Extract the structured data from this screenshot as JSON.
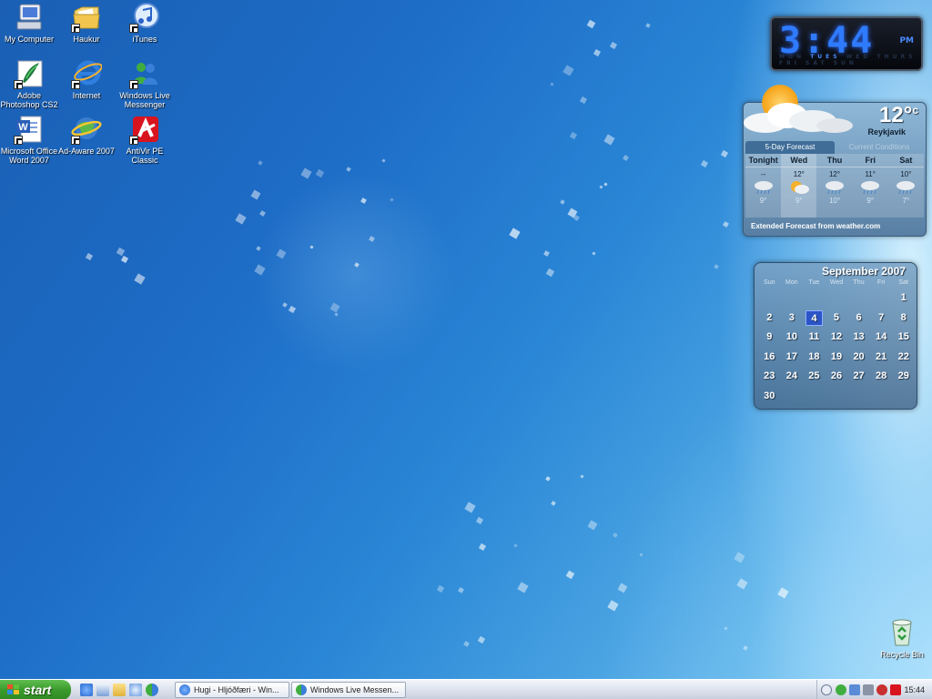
{
  "desktop_icons": [
    {
      "label": "My Computer",
      "icon": "computer-icon"
    },
    {
      "label": "Haukur",
      "icon": "folder-icon"
    },
    {
      "label": "iTunes",
      "icon": "itunes-icon"
    },
    {
      "label": "Adobe Photoshop CS2",
      "icon": "photoshop-icon"
    },
    {
      "label": "Internet",
      "icon": "internet-explorer-icon"
    },
    {
      "label": "Windows Live Messenger",
      "icon": "messenger-icon"
    },
    {
      "label": "Microsoft Office Word 2007",
      "icon": "word-icon"
    },
    {
      "label": "Ad-Aware 2007",
      "icon": "adaware-icon"
    },
    {
      "label": "AntiVir PE Classic",
      "icon": "antivir-icon"
    },
    {
      "label": "Recycle Bin",
      "icon": "recycle-bin-icon"
    }
  ],
  "clock": {
    "time": "3:44",
    "ampm": "PM",
    "days": [
      "MON",
      "TUES",
      "WED",
      "THURS",
      "FRI",
      "SAT",
      "SUN"
    ],
    "active_day": "TUES"
  },
  "weather": {
    "temp": "12°",
    "unit": "c",
    "city": "Reykjavik",
    "tabs": [
      "5-Day Forecast",
      "Current Conditions"
    ],
    "active_tab": "5-Day Forecast",
    "forecast": [
      {
        "day": "Tonight",
        "high": "--",
        "low": "9°",
        "icon": "rain-icon"
      },
      {
        "day": "Wed",
        "high": "12°",
        "low": "9°",
        "icon": "sun-cloud-icon"
      },
      {
        "day": "Thu",
        "high": "12°",
        "low": "10°",
        "icon": "rain-icon"
      },
      {
        "day": "Fri",
        "high": "11°",
        "low": "9°",
        "icon": "rain-icon"
      },
      {
        "day": "Sat",
        "high": "10°",
        "low": "7°",
        "icon": "rain-icon"
      }
    ],
    "extended_link": "Extended Forecast from weather.com"
  },
  "calendar": {
    "title": "September 2007",
    "weekdays": [
      "Sun",
      "Mon",
      "Tue",
      "Wed",
      "Thu",
      "Fri",
      "Sat"
    ],
    "weeks": [
      [
        "",
        "",
        "",
        "",
        "",
        "",
        "1"
      ],
      [
        "2",
        "3",
        "4",
        "5",
        "6",
        "7",
        "8"
      ],
      [
        "9",
        "10",
        "11",
        "12",
        "13",
        "14",
        "15"
      ],
      [
        "16",
        "17",
        "18",
        "19",
        "20",
        "21",
        "22"
      ],
      [
        "23",
        "24",
        "25",
        "26",
        "27",
        "28",
        "29"
      ],
      [
        "30",
        "",
        "",
        "",
        "",
        "",
        ""
      ]
    ],
    "today": "4"
  },
  "taskbar": {
    "start_label": "start",
    "quick_launch": [
      "ie-icon",
      "outlook-icon",
      "folder-icon",
      "itunes-icon",
      "messenger-icon"
    ],
    "tasks": [
      {
        "label": "Hugi - Hljóðfæri - Win...",
        "icon": "ie-icon"
      },
      {
        "label": "Windows Live Messen...",
        "icon": "messenger-icon"
      }
    ],
    "tray_icons": [
      "expand-arrow-icon",
      "messenger-tray-icon",
      "network-icon",
      "volume-icon",
      "security-icon",
      "antivir-tray-icon"
    ],
    "clock": "15:44"
  }
}
